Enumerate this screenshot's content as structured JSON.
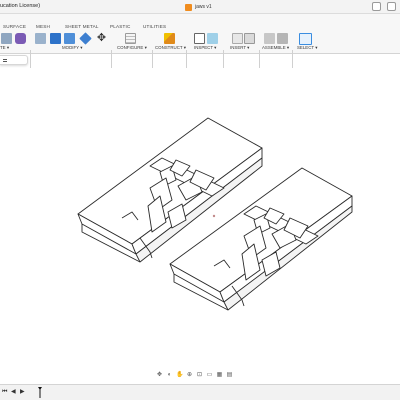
{
  "window": {
    "title": "ucation License)",
    "document_tab": "jaws v1"
  },
  "workspace_tabs": [
    "SURFACE",
    "MESH",
    "SHEET METAL",
    "PLASTIC",
    "UTILITIES"
  ],
  "toolbar_groups": {
    "create_fragment": "TE ▾",
    "modify": "MODIFY ▾",
    "configure": "CONFIGURE ▾",
    "construct": "CONSTRUCT ▾",
    "inspect": "INSPECT ▾",
    "insert": "INSERT ▾",
    "assemble": "ASSEMBLE ▾",
    "select": "SELECT ▾"
  },
  "colors": {
    "accent_blue": "#2d72c9",
    "select_tool": "#3a8de0",
    "model_edge": "#2b2b2b",
    "model_face": "#ffffff",
    "document_icon": "#f08c1e"
  },
  "icons": {
    "timeline_first": "skip-back-icon",
    "timeline_prev": "step-back-icon",
    "timeline_play": "play-icon",
    "timeline_marker": "timeline-marker-icon"
  }
}
